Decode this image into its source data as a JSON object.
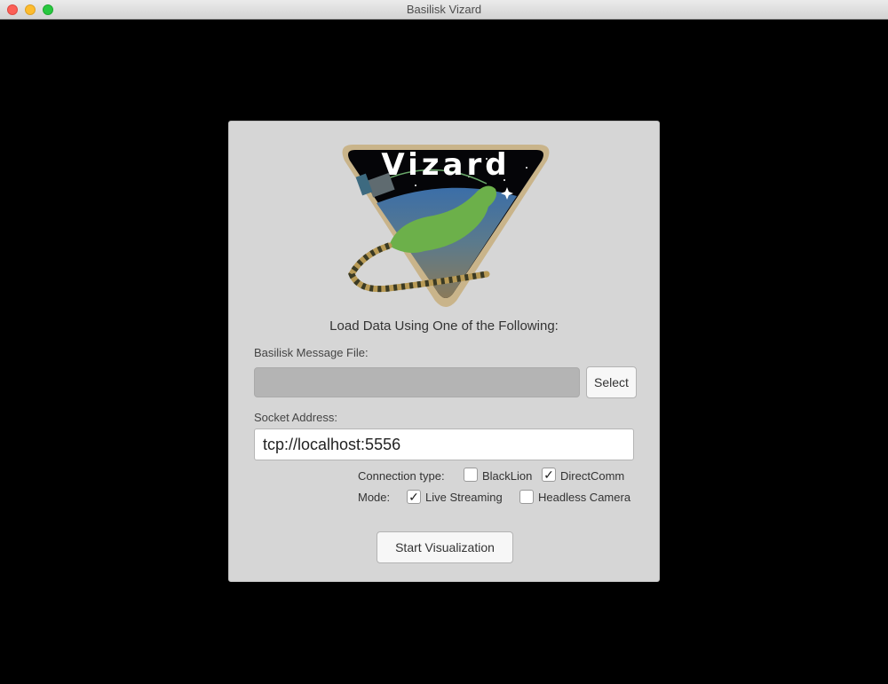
{
  "window": {
    "title": "Basilisk Vizard"
  },
  "logo": {
    "text": "Vizard",
    "icon": "lizard-satellite-emblem"
  },
  "panel": {
    "heading": "Load Data Using One of the Following:",
    "file_label": "Basilisk Message File:",
    "file_value": "",
    "select_label": "Select",
    "socket_label": "Socket Address:",
    "socket_value": "tcp://localhost:5556",
    "connection_label": "Connection type:",
    "connection_options": [
      {
        "label": "BlackLion",
        "checked": false
      },
      {
        "label": "DirectComm",
        "checked": true
      }
    ],
    "mode_label": "Mode:",
    "mode_options": [
      {
        "label": "Live Streaming",
        "checked": true
      },
      {
        "label": "Headless Camera",
        "checked": false
      }
    ],
    "start_label": "Start Visualization"
  },
  "colors": {
    "panel_bg": "#d6d6d6",
    "background": "#000000",
    "logo_border": "#c9b48a"
  }
}
